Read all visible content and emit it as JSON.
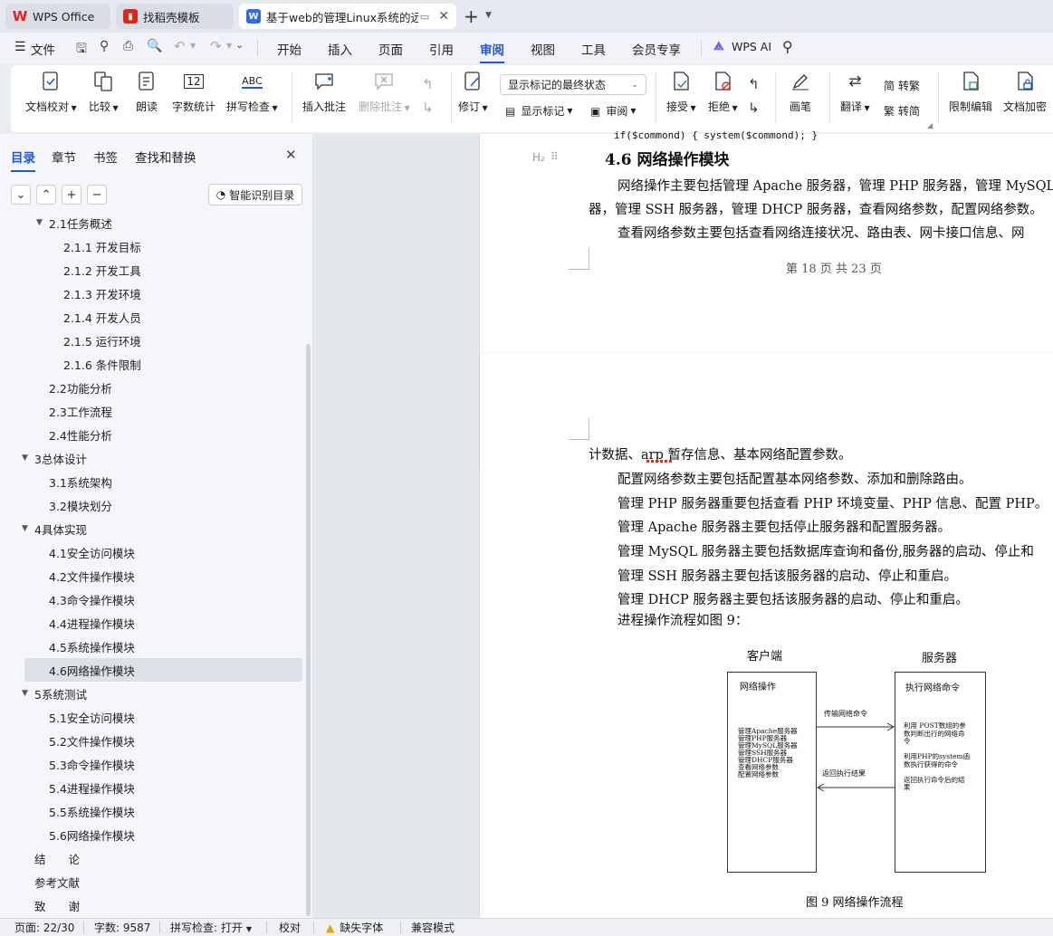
{
  "tabs": [
    {
      "label": "WPS Office",
      "active": false
    },
    {
      "label": "找稻壳模板",
      "active": false
    },
    {
      "label": "基于web的管理Linux系统的远",
      "active": true
    }
  ],
  "menu": [
    "文件",
    "开始",
    "插入",
    "页面",
    "引用",
    "审阅",
    "视图",
    "工具",
    "会员专享",
    "WPS AI"
  ],
  "menu_active": "审阅",
  "ribbon": {
    "doc_check": "文档校对",
    "compare": "比较",
    "read_aloud": "朗读",
    "word_count": "字数统计",
    "spell_check": "拼写检查",
    "insert_comment": "插入批注",
    "delete_comment": "删除批注",
    "revise": "修订",
    "show_mode": "显示标记的最终状态",
    "show_marks": "显示标记",
    "review": "审阅",
    "accept": "接受",
    "reject": "拒绝",
    "pen": "画笔",
    "translate": "翻译",
    "to_traditional": "转繁",
    "to_simplified": "转简",
    "restrict_edit": "限制编辑",
    "encrypt": "文档加密",
    "word_count_icon_text": "12",
    "spell_icon_text": "ABC"
  },
  "left_panel": {
    "tabs": [
      "目录",
      "章节",
      "书签",
      "查找和替换"
    ],
    "smart_toc": "智能识别目录",
    "toc": [
      {
        "label": "2.1任务概述",
        "level": 2,
        "caret": true
      },
      {
        "label": "2.1.1 开发目标",
        "level": 3
      },
      {
        "label": "2.1.2 开发工具",
        "level": 3
      },
      {
        "label": "2.1.3 开发环境",
        "level": 3
      },
      {
        "label": "2.1.4 开发人员",
        "level": 3
      },
      {
        "label": "2.1.5 运行环境",
        "level": 3
      },
      {
        "label": "2.1.6 条件限制",
        "level": 3
      },
      {
        "label": "2.2功能分析",
        "level": 2
      },
      {
        "label": "2.3工作流程",
        "level": 2
      },
      {
        "label": "2.4性能分析",
        "level": 2
      },
      {
        "label": "3总体设计",
        "level": 1,
        "caret": true
      },
      {
        "label": "3.1系统架构",
        "level": 2
      },
      {
        "label": "3.2模块划分",
        "level": 2
      },
      {
        "label": "4具体实现",
        "level": 1,
        "caret": true
      },
      {
        "label": "4.1安全访问模块",
        "level": 2
      },
      {
        "label": "4.2文件操作模块",
        "level": 2
      },
      {
        "label": "4.3命令操作模块",
        "level": 2
      },
      {
        "label": "4.4进程操作模块",
        "level": 2
      },
      {
        "label": "4.5系统操作模块",
        "level": 2
      },
      {
        "label": "4.6网络操作模块",
        "level": 2,
        "selected": true
      },
      {
        "label": "5系统测试",
        "level": 1,
        "caret": true
      },
      {
        "label": "5.1安全访问模块",
        "level": 2
      },
      {
        "label": "5.2文件操作模块",
        "level": 2
      },
      {
        "label": "5.3命令操作模块",
        "level": 2
      },
      {
        "label": "5.4进程操作模块",
        "level": 2
      },
      {
        "label": "5.5系统操作模块",
        "level": 2
      },
      {
        "label": "5.6网络操作模块",
        "level": 2
      },
      {
        "label": "结　　论",
        "level": 1
      },
      {
        "label": "参考文献",
        "level": 1
      },
      {
        "label": "致　　谢",
        "level": 1
      }
    ]
  },
  "document": {
    "code_line": "if($commond)  { system($commond); }",
    "heading_marker": "H₂",
    "heading": "4.6  网络操作模块",
    "p1a": "网络操作主要包括管理 Apache 服务器，管理 PHP 服务器，管理 MySQL",
    "p1b": "器，管理 SSH 服务器，管理 DHCP 服务器，查看网络参数，配置网络参数。",
    "p2": "查看网络参数主要包括查看网络连接状况、路由表、网卡接口信息、网",
    "page_footer": "第 18 页 共 23 页",
    "p3": "计数据、arp 暂存信息、基本网络配置参数。",
    "p4": "配置网络参数主要包括配置基本网络参数、添加和删除路由。",
    "p5": "管理 PHP 服务器重要包括查看 PHP 环境变量、PHP 信息、配置 PHP。",
    "p6": "管理 Apache 服务器主要包括停止服务器和配置服务器。",
    "p7": "管理 MySQL 服务器主要包括数据库查询和备份,服务器的启动、停止和",
    "p8": "管理 SSH 服务器主要包括该服务器的启动、停止和重启。",
    "p9": "管理 DHCP 服务器主要包括该服务器的启动、停止和重启。",
    "p10": "进程操作流程如图 9：",
    "figure": {
      "client_title": "客户端",
      "server_title": "服务器",
      "client_box_title": "网络操作",
      "client_items": [
        "管理Apache服务器",
        "管理PHP服务器",
        "管理MySQL服务器",
        "管理SSH服务器",
        "管理DHCP服务器",
        "查看网络参数",
        "配置网络参数"
      ],
      "server_box_title": "执行网络命令",
      "server_items": [
        "利用 POST数组的参",
        "数判断出行的网络命",
        "令",
        "",
        "利用PHP的system函",
        "数执行获得的命令",
        "",
        "返回执行命令后的结",
        "果"
      ],
      "arrow_send": "传输网络命令",
      "arrow_return": "返回执行结果",
      "caption": "图 9  网络操作流程"
    }
  },
  "status": {
    "page": "页面: 22/30",
    "words": "字数: 9587",
    "spell": "拼写检查: 打开",
    "proof": "校对",
    "missing_font": "缺失字体",
    "compat": "兼容模式"
  }
}
